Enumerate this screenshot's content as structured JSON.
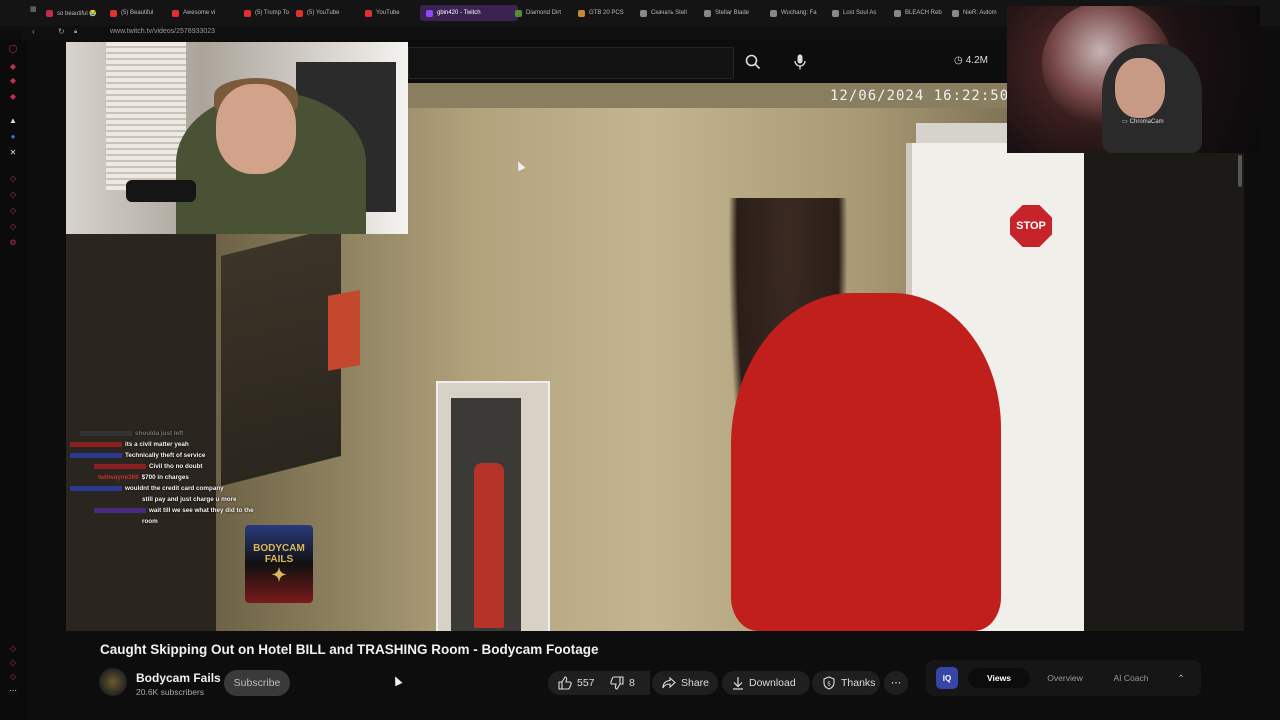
{
  "browser": {
    "tabs": [
      {
        "label": "so beautiful 😭",
        "color": "#c22b4a"
      },
      {
        "label": "(5) Beautiful",
        "color": "#e2312d"
      },
      {
        "label": "Awesome vi",
        "color": "#e2312d"
      },
      {
        "label": "(5) Trump To",
        "color": "#e2312d"
      },
      {
        "label": "(5) YouTube",
        "color": "#e2312d"
      },
      {
        "label": "YouTube",
        "color": "#e2312d"
      },
      {
        "label": "gbin420 - Twitch",
        "color": "#9146ff",
        "active": true
      },
      {
        "label": "Diamond Dirt",
        "color": "#5a8a3a"
      },
      {
        "label": "GTB 20 PCS",
        "color": "#c88a2a"
      },
      {
        "label": "Скачать Stell",
        "color": "#888888"
      },
      {
        "label": "Stellar Blade",
        "color": "#888888"
      },
      {
        "label": "Wuchang: Fa",
        "color": "#888888"
      },
      {
        "label": "Lost Soul As",
        "color": "#888888"
      },
      {
        "label": "BLEACH Reb",
        "color": "#888888"
      },
      {
        "label": "NieR: Autom",
        "color": "#888888"
      }
    ],
    "url": "www.twitch.tv/videos/2578933023"
  },
  "youtube": {
    "view_count": "4.2M",
    "timestamp_overlay": "12/06/2024 16:22:50  BWC",
    "video_title": "Caught Skipping Out on Hotel BILL and TRASHING Room - Bodycam Footage",
    "channel_name": "Bodycam Fails",
    "subscribers": "20.6K subscribers",
    "subscribe_label": "Subscribe",
    "likes": "557",
    "dislikes": "8",
    "share_label": "Share",
    "download_label": "Download",
    "thanks_label": "Thanks",
    "logo_text": "BODYCAM FAILS"
  },
  "extension": {
    "logo": "IQ",
    "tabs": [
      "Views",
      "Overview",
      "AI Coach"
    ],
    "active_tab": "Views"
  },
  "webcam_right_label": "ChromaCam",
  "chat": [
    {
      "user": "",
      "message": "shoulda just left",
      "dim": true
    },
    {
      "user": "",
      "message": "its a civil matter yeah",
      "color": "r"
    },
    {
      "user": "",
      "message": "Technically theft of service",
      "color": "b"
    },
    {
      "user": "",
      "message": "Civil tho no doubt",
      "color": "r"
    },
    {
      "user": "twitwayne369",
      "message": "$700 in charges",
      "color": "r"
    },
    {
      "user": "",
      "message": "wouldnt the credit card company",
      "color": "b"
    },
    {
      "user": "",
      "message": "still pay and just charge u more",
      "color": "none"
    },
    {
      "user": "",
      "message": "wait till we see what they did to the",
      "color": "p"
    },
    {
      "user": "",
      "message": "room",
      "color": "none"
    }
  ]
}
